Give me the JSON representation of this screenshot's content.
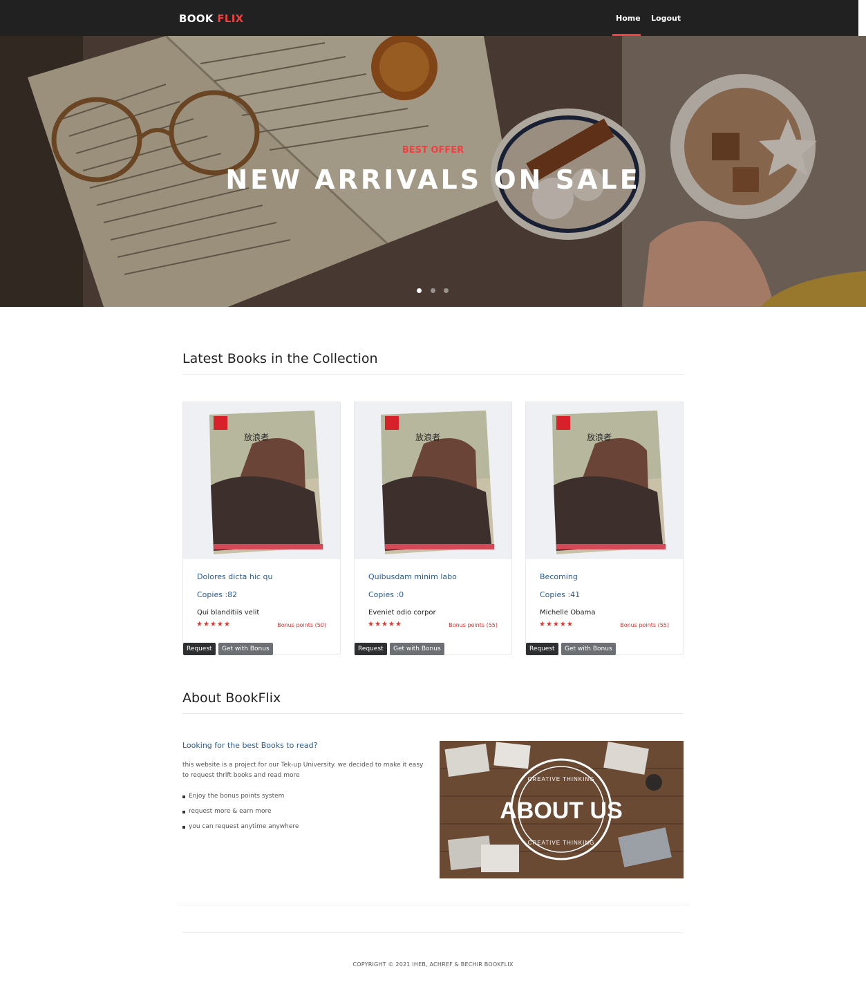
{
  "navbar": {
    "brand_main": "BOOK",
    "brand_accent": "FLIX",
    "links": [
      {
        "label": "Home",
        "active": true
      },
      {
        "label": "Logout",
        "active": false
      }
    ],
    "accent_color": "#f33f3f",
    "background_color": "#222121"
  },
  "hero": {
    "kicker": "BEST OFFER",
    "title": "NEW ARRIVALS ON SALE",
    "slides_count": 3,
    "active_slide": 1
  },
  "latest": {
    "heading": "Latest Books in the Collection",
    "books": [
      {
        "title": "Dolores dicta hic qu",
        "copies": "Copies :82",
        "author": "Qui blanditiis velit",
        "stars": "★★★★★",
        "bonus": "Bonus points (50)",
        "request_label": "Request",
        "bonus_button_label": "Get with Bonus"
      },
      {
        "title": "Quibusdam minim labo",
        "copies": "Copies :0",
        "author": "Eveniet odio corpor",
        "stars": "★★★★★",
        "bonus": "Bonus points (55)",
        "request_label": "Request",
        "bonus_button_label": "Get with Bonus"
      },
      {
        "title": "Becoming",
        "copies": "Copies :41",
        "author": "Michelle Obama",
        "stars": "★★★★★",
        "bonus": "Bonus points (55)",
        "request_label": "Request",
        "bonus_button_label": "Get with Bonus"
      }
    ],
    "cover_text": "放浪者"
  },
  "about": {
    "heading": "About BookFlix",
    "subheading": "Looking for the best Books to read?",
    "text": "this website is a project for our Tek-up University. we decided to make it easy to request thrift books and read more",
    "features": [
      "Enjoy the bonus points system",
      "request more & earn more",
      "you can request anytime anywhere"
    ],
    "image_title": "ABOUT US",
    "image_ring_text": "CREATIVE THINKING"
  },
  "footer": {
    "copyright": "COPYRIGHT © 2021 IHEB, ACHREF & BECHIR BOOKFLIX"
  }
}
